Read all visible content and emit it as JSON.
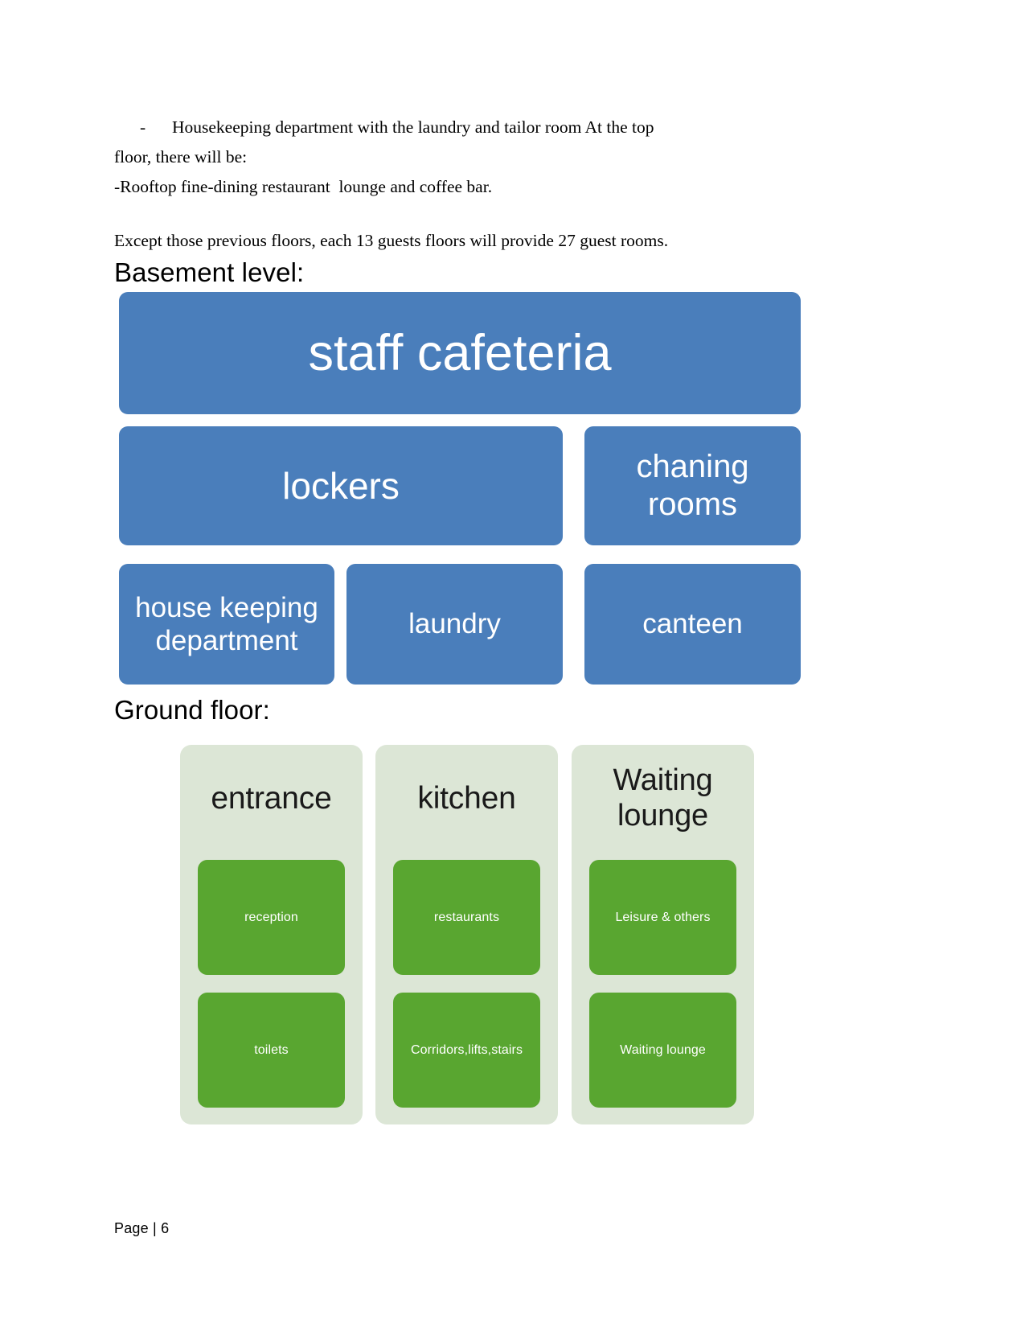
{
  "document": {
    "paragraphs": {
      "bullet1_dash": "-",
      "bullet1_text": "Housekeeping  department  with  the  laundry  and  tailor  room  At  the  top",
      "bullet1_cont": "floor, there will be:",
      "bullet2_dash": "-",
      "bullet2_text": "Rooftop fine-dining restaurant  lounge and coffee bar.",
      "summary": "Except those previous floors, each 13 guests floors will provide 27 guest rooms."
    },
    "headings": {
      "basement": "Basement level:",
      "ground": "Ground floor:"
    },
    "footer": "Page | 6"
  },
  "colors": {
    "blue_box": "#4a7ebb",
    "green_light": "#dce6d6",
    "green_dark": "#59a630",
    "box_text": "#ffffff",
    "title_text": "#1a1a1a",
    "page_background": "#ffffff"
  },
  "basement_diagram": {
    "title": "Basement level:",
    "boxes": [
      {
        "label": "staff cafeteria",
        "row": 1
      },
      {
        "label": "lockers",
        "row": 2
      },
      {
        "label": "chaning rooms",
        "row": 2
      },
      {
        "label": "house keeping department",
        "row": 3
      },
      {
        "label": "laundry",
        "row": 3
      },
      {
        "label": "canteen",
        "row": 3
      }
    ]
  },
  "ground_diagram": {
    "title": "Ground floor:",
    "columns": [
      {
        "title": "entrance",
        "items": [
          "reception",
          "toilets"
        ]
      },
      {
        "title": "kitchen",
        "items": [
          "restaurants",
          "Corridors,lifts,stairs"
        ]
      },
      {
        "title": "Waiting lounge",
        "items": [
          "Leisure & others",
          "Waiting lounge"
        ]
      }
    ]
  }
}
